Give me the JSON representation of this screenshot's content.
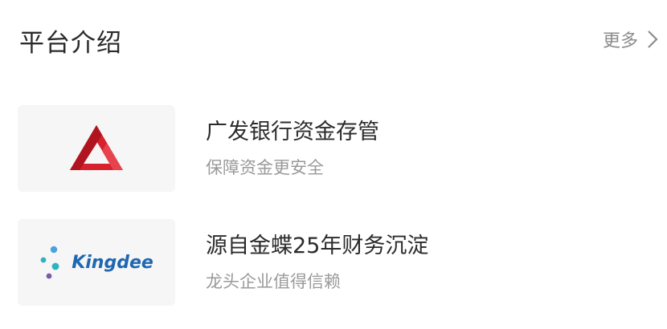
{
  "header": {
    "title": "平台介绍",
    "more_label": "更多"
  },
  "items": [
    {
      "title": "广发银行资金存管",
      "subtitle": "保障资金更安全",
      "logo_icon": "cgb-bank-logo-icon"
    },
    {
      "title": "源自金蝶25年财务沉淀",
      "subtitle": "龙头企业值得信赖",
      "logo_icon": "kingdee-logo-icon",
      "logo_text": "Kingdee"
    }
  ],
  "colors": {
    "cgb_red": "#d7212d",
    "kingdee_blue": "#1f67b1",
    "kingdee_teal": "#2bb3c0",
    "kingdee_purple": "#7a59a5",
    "kingdee_sky": "#4aa3df"
  }
}
